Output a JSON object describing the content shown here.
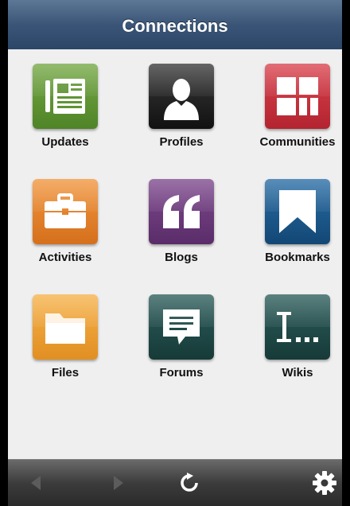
{
  "header": {
    "title": "Connections"
  },
  "apps": [
    {
      "label": "Updates",
      "icon": "newspaper-icon",
      "color": "#5f9433"
    },
    {
      "label": "Profiles",
      "icon": "person-silhouette-icon",
      "color": "#1d1d1d"
    },
    {
      "label": "Communities",
      "icon": "communities-grid-icon",
      "color": "#c8303c"
    },
    {
      "label": "Activities",
      "icon": "briefcase-icon",
      "color": "#e4822a"
    },
    {
      "label": "Blogs",
      "icon": "quote-icon",
      "color": "#6b3a7a"
    },
    {
      "label": "Bookmarks",
      "icon": "bookmark-icon",
      "color": "#1b5a8e"
    },
    {
      "label": "Files",
      "icon": "folder-icon",
      "color": "#f0a33a"
    },
    {
      "label": "Forums",
      "icon": "speech-bubble-icon",
      "color": "#1f4a48"
    },
    {
      "label": "Wikis",
      "icon": "wiki-cursor-icon",
      "color": "#1f4a48"
    }
  ],
  "toolbar": {
    "back_icon": "back-arrow-icon",
    "forward_icon": "forward-arrow-icon",
    "refresh_icon": "refresh-icon",
    "settings_icon": "gear-icon"
  }
}
